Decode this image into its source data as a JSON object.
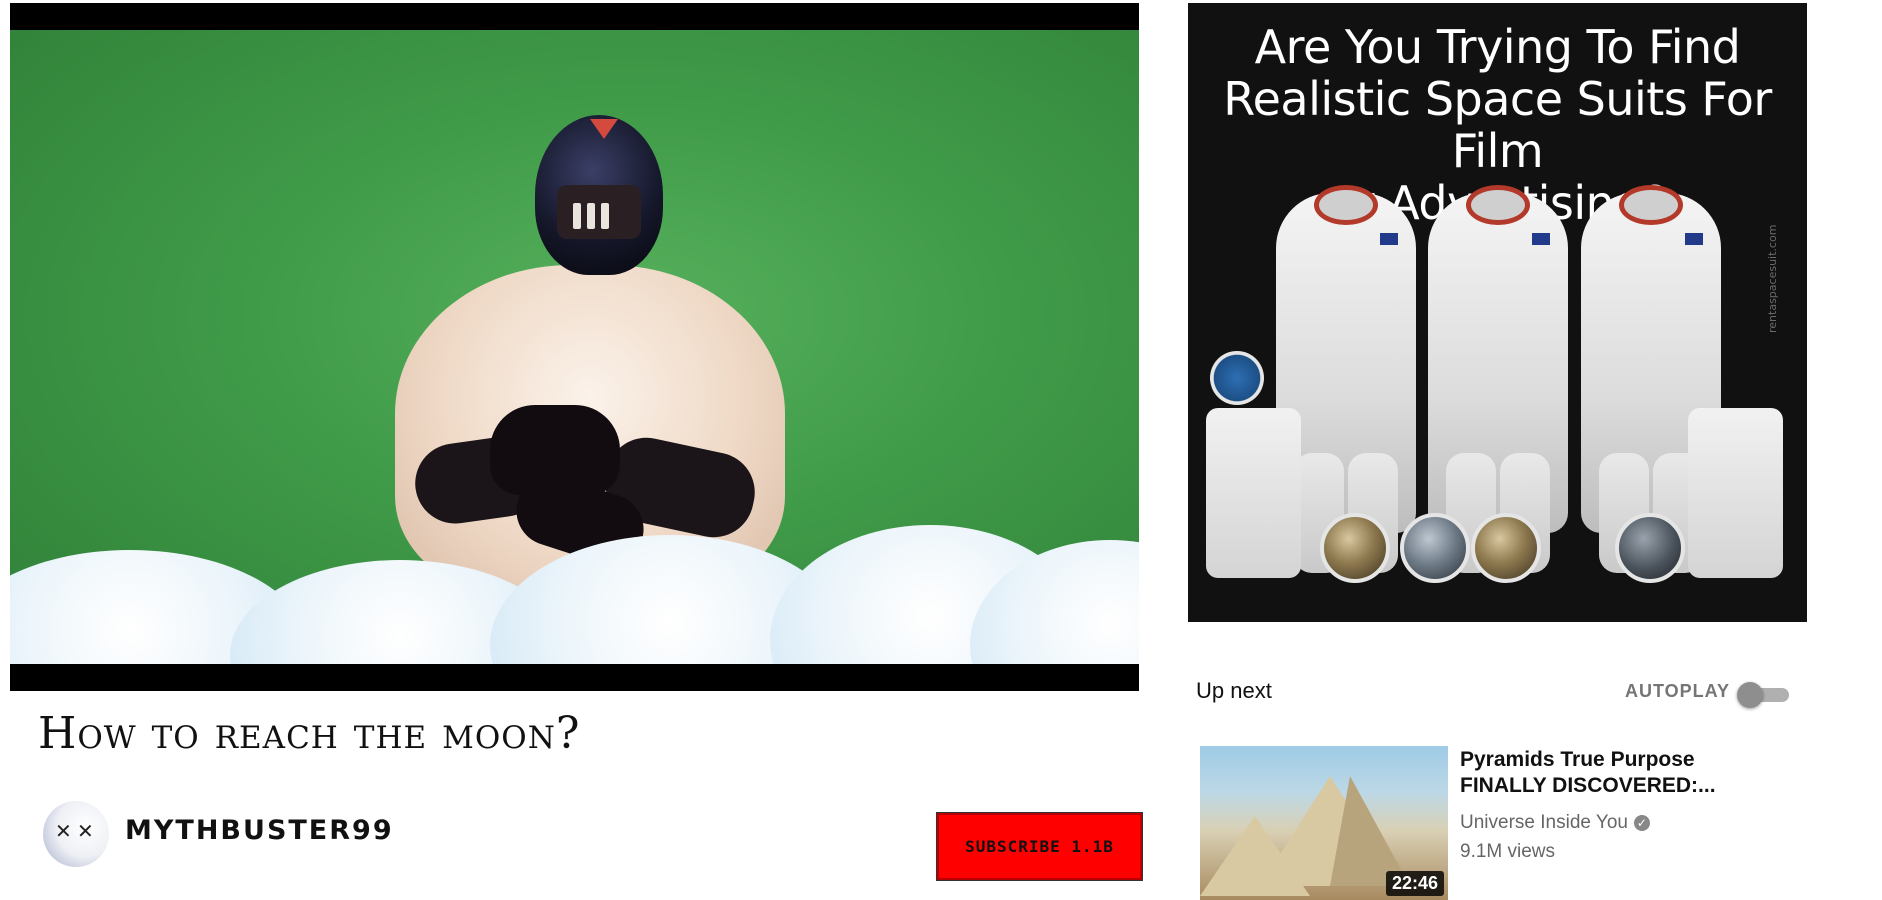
{
  "video": {
    "title": "How to reach the moon?"
  },
  "channel": {
    "name": "Mythbuster99",
    "subscribe_label": "Subscribe 1.1B"
  },
  "ad": {
    "headline": "Are You Trying To Find\nRealistic Space Suits For Film\nor Advertising?",
    "watermark": "rentaspacesuit.com"
  },
  "sidebar": {
    "up_next_label": "Up next",
    "autoplay_label": "AUTOPLAY",
    "autoplay_on": false,
    "recommendations": [
      {
        "title": "Pyramids True Purpose FINALLY DISCOVERED:...",
        "channel": "Universe Inside You",
        "verified": true,
        "views": "9.1M views",
        "duration": "22:46"
      }
    ]
  },
  "icons": {
    "verified": "check-icon",
    "avatar_eyes": "x-eyes"
  },
  "colors": {
    "subscribe_bg": "#ff0000",
    "green_screen": "#3f9a48",
    "ad_bg": "#111111"
  }
}
